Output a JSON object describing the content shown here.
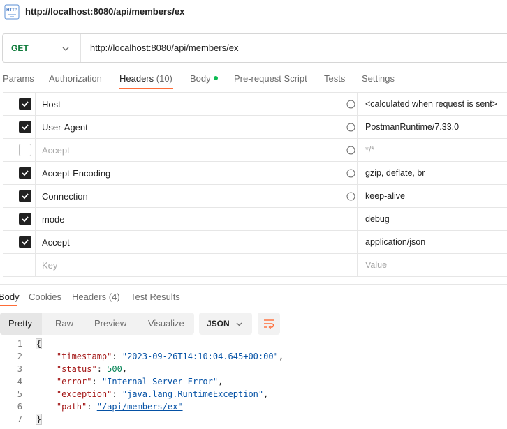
{
  "request": {
    "title": "http://localhost:8080/api/members/ex",
    "method": "GET",
    "url": "http://localhost:8080/api/members/ex"
  },
  "request_tabs": [
    {
      "label": "Params"
    },
    {
      "label": "Authorization"
    },
    {
      "label": "Headers",
      "count": "(10)"
    },
    {
      "label": "Body"
    },
    {
      "label": "Pre-request Script"
    },
    {
      "label": "Tests"
    },
    {
      "label": "Settings"
    }
  ],
  "headers": [
    {
      "key": "Host",
      "value": "<calculated when request is sent>",
      "checked": true
    },
    {
      "key": "User-Agent",
      "value": "PostmanRuntime/7.33.0",
      "checked": true
    },
    {
      "key": "Accept",
      "value": "*/*",
      "checked": false
    },
    {
      "key": "Accept-Encoding",
      "value": "gzip, deflate, br",
      "checked": true
    },
    {
      "key": "Connection",
      "value": "keep-alive",
      "checked": true
    },
    {
      "key": "mode",
      "value": "debug",
      "checked": true
    },
    {
      "key": "Accept",
      "value": "application/json",
      "checked": true
    }
  ],
  "new_header": {
    "key_placeholder": "Key",
    "value_placeholder": "Value"
  },
  "response_tabs": [
    {
      "label": "Body"
    },
    {
      "label": "Cookies"
    },
    {
      "label": "Headers",
      "count": "(4)"
    },
    {
      "label": "Test Results"
    }
  ],
  "view_modes": [
    "Pretty",
    "Raw",
    "Preview",
    "Visualize"
  ],
  "format": "JSON",
  "response_body": {
    "line_numbers": [
      "1",
      "2",
      "3",
      "4",
      "5",
      "6",
      "7"
    ],
    "open_brace": "{",
    "close_brace": "}",
    "fields": [
      {
        "key": "\"timestamp\"",
        "value": "\"2023-09-26T14:10:04.645+00:00\"",
        "kind": "string"
      },
      {
        "key": "\"status\"",
        "value": "500",
        "kind": "number"
      },
      {
        "key": "\"error\"",
        "value": "\"Internal Server Error\"",
        "kind": "string"
      },
      {
        "key": "\"exception\"",
        "value": "\"java.lang.RuntimeException\"",
        "kind": "string"
      },
      {
        "key": "\"path\"",
        "value": "\"/api/members/ex\"",
        "kind": "link"
      }
    ]
  },
  "colors": {
    "accent": "#ff6c37",
    "method_get": "#0e7a3a",
    "body_dot": "#0cbb52"
  }
}
